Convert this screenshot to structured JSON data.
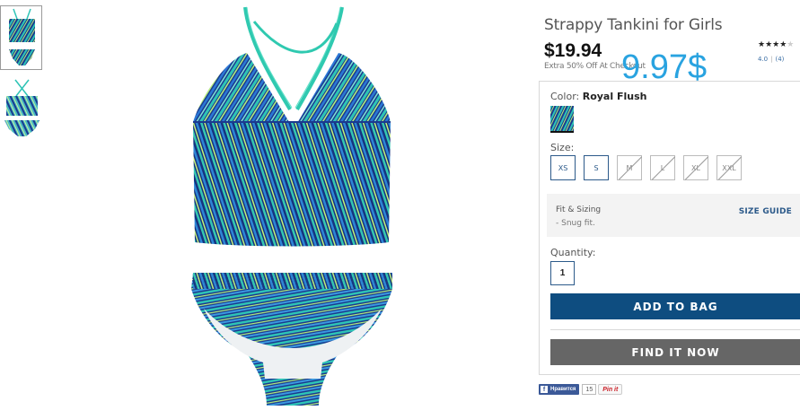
{
  "product": {
    "title": "Strappy Tankini for Girls",
    "price": "$19.94",
    "promo": "Extra 50% Off At Checkout",
    "sale_overlay": "9.97$",
    "rating": {
      "stars_filled": 4,
      "stars_total": 5,
      "score": "4.0",
      "count": "(4)"
    }
  },
  "color": {
    "label": "Color:",
    "value": "Royal Flush"
  },
  "size": {
    "label": "Size:",
    "options": [
      {
        "label": "XS",
        "state": "selected"
      },
      {
        "label": "S",
        "state": "available"
      },
      {
        "label": "M",
        "state": "unavailable"
      },
      {
        "label": "L",
        "state": "unavailable"
      },
      {
        "label": "XL",
        "state": "unavailable"
      },
      {
        "label": "XXL",
        "state": "unavailable"
      }
    ]
  },
  "fit": {
    "title": "Fit & Sizing",
    "note": "- Snug fit.",
    "guide_link": "SIZE GUIDE"
  },
  "quantity": {
    "label": "Quantity:",
    "value": "1"
  },
  "buttons": {
    "add_to_bag": "ADD TO BAG",
    "find_it_now": "FIND IT NOW"
  },
  "social": {
    "facebook_label": "Нравится",
    "facebook_count": "15",
    "pinterest_label": "Pin it"
  },
  "colors": {
    "brand_blue": "#0e4d80",
    "find_gray": "#666666",
    "link_blue": "#2c5a8a",
    "sale_overlay": "#29a3e0",
    "swimsuit_teal": "#2ec4b6",
    "swimsuit_navy": "#1b3a8f"
  }
}
